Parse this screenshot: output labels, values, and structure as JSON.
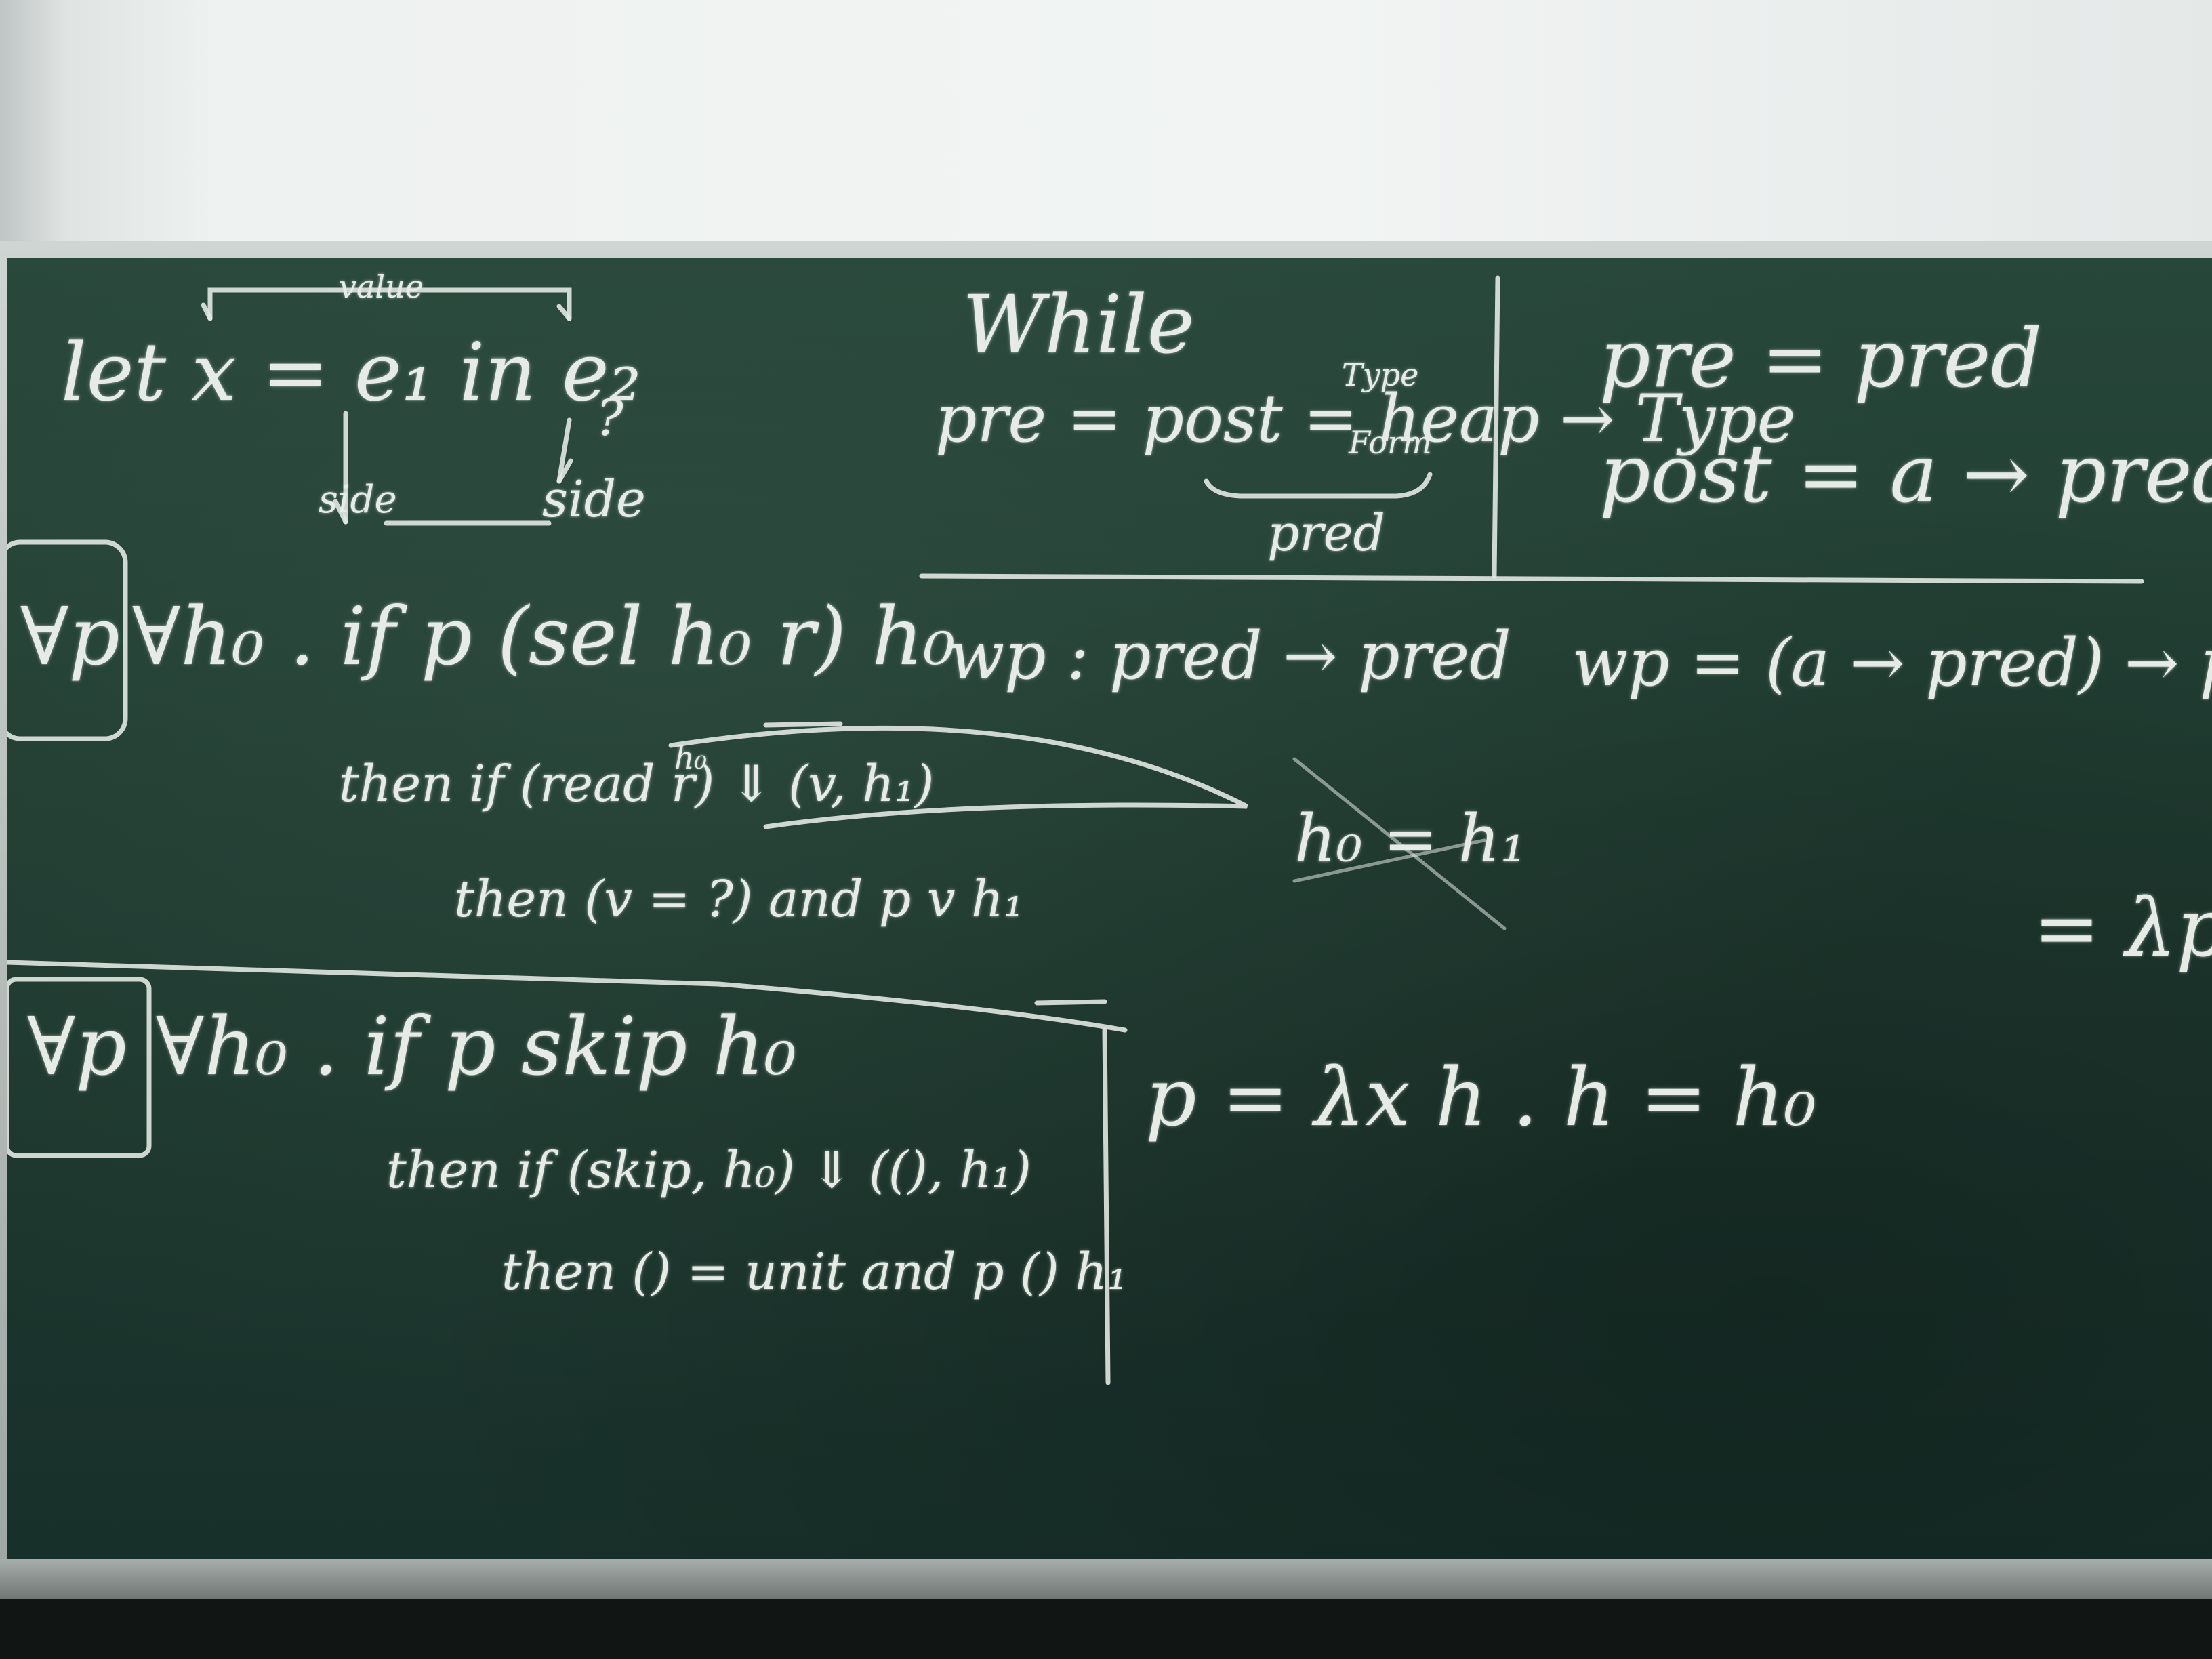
{
  "board": {
    "let_block": {
      "annotation_top": "value",
      "expression": "let x = e₁ in e₂",
      "mark_q": "?",
      "label_left": "side",
      "label_right": "side"
    },
    "while_block": {
      "title": "While",
      "equation": "pre = post = heap → Type",
      "term_top": "Type",
      "term_bottom": "Form",
      "brace_label": "pred"
    },
    "right_block": {
      "line1": "pre = pred",
      "line2": "post = a → pred"
    },
    "wp_line": {
      "left": "wp : pred → pred",
      "right": "wp = (a → pred) → pred"
    },
    "read_block": {
      "head_quantifier": "∀p",
      "head_rest": "∀h₀ . if p (sel h₀ r) h₀",
      "line2": "then if (read r) ⇓ (v, h₁)",
      "superscript": "h₀",
      "line3": "then (v = ?) and p v h₁",
      "crossed": "h₀ = h₁"
    },
    "right_edge": "= λp",
    "skip_block": {
      "head_quantifier": "∀p",
      "head_rest": "∀h₀ . if p skip h₀",
      "line2": "then if (skip, h₀) ⇓ ((), h₁)",
      "line3": "then () = unit and p () h₁"
    },
    "p_def": "p = λx h . h = h₀"
  }
}
